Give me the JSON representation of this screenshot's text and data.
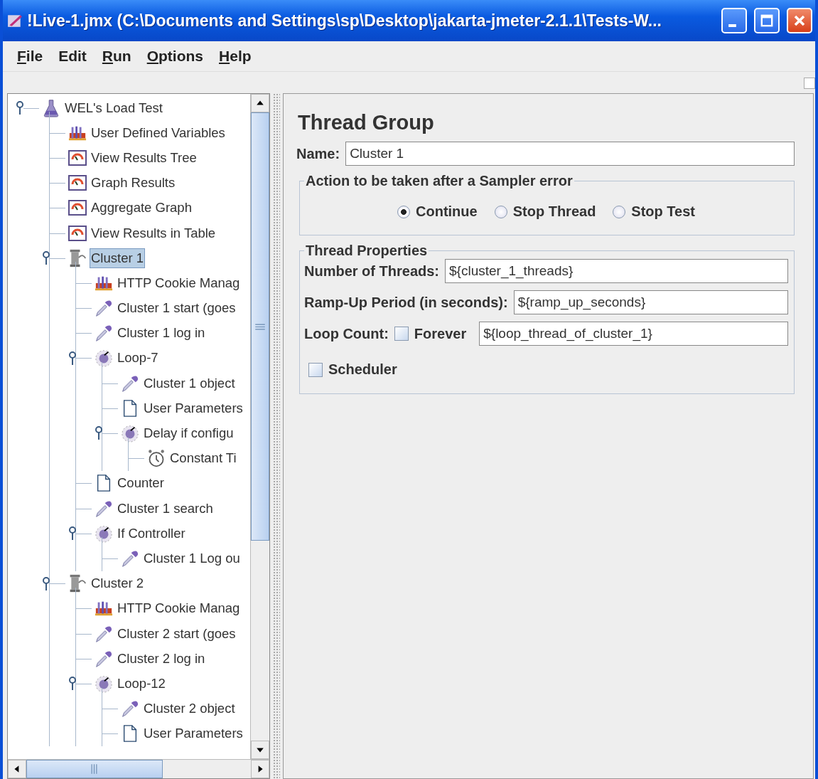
{
  "window": {
    "title": "!Live-1.jmx (C:\\Documents and Settings\\sp\\Desktop\\jakarta-jmeter-2.1.1\\Tests-W..."
  },
  "menu": [
    {
      "label": "File",
      "mnemonic": true
    },
    {
      "label": "Edit",
      "mnemonic": false
    },
    {
      "label": "Run",
      "mnemonic": true
    },
    {
      "label": "Options",
      "mnemonic": true
    },
    {
      "label": "Help",
      "mnemonic": true
    }
  ],
  "tree": [
    {
      "label": "WEL's Load Test",
      "kind": "plan",
      "expanded": true,
      "selected": false,
      "children": [
        {
          "label": "User Defined Variables",
          "kind": "config",
          "selected": false
        },
        {
          "label": "View Results Tree",
          "kind": "listener",
          "selected": false
        },
        {
          "label": "Graph Results",
          "kind": "listener",
          "selected": false
        },
        {
          "label": "Aggregate Graph",
          "kind": "listener",
          "selected": false
        },
        {
          "label": "View Results in Table",
          "kind": "listener",
          "selected": false
        },
        {
          "label": "Cluster 1",
          "kind": "thread",
          "expanded": true,
          "selected": true,
          "children": [
            {
              "label": "HTTP Cookie Manag",
              "kind": "config",
              "selected": false
            },
            {
              "label": "Cluster 1 start (goes",
              "kind": "sampler",
              "selected": false
            },
            {
              "label": "Cluster 1 log in",
              "kind": "sampler",
              "selected": false
            },
            {
              "label": "Loop-7",
              "kind": "controller",
              "expanded": true,
              "selected": false,
              "children": [
                {
                  "label": "Cluster 1 object",
                  "kind": "sampler",
                  "selected": false
                },
                {
                  "label": "User Parameters",
                  "kind": "page",
                  "selected": false
                },
                {
                  "label": "Delay if configu",
                  "kind": "controller",
                  "expanded": true,
                  "selected": false,
                  "children": [
                    {
                      "label": "Constant Ti",
                      "kind": "timer",
                      "selected": false
                    }
                  ]
                }
              ]
            },
            {
              "label": "Counter",
              "kind": "page",
              "selected": false
            },
            {
              "label": "Cluster 1 search",
              "kind": "sampler",
              "selected": false
            },
            {
              "label": "If Controller",
              "kind": "controller",
              "expanded": true,
              "selected": false,
              "children": [
                {
                  "label": "Cluster 1 Log ou",
                  "kind": "sampler",
                  "selected": false
                }
              ]
            }
          ]
        },
        {
          "label": "Cluster 2",
          "kind": "thread",
          "expanded": true,
          "selected": false,
          "children": [
            {
              "label": "HTTP Cookie Manag",
              "kind": "config",
              "selected": false
            },
            {
              "label": "Cluster 2 start (goes",
              "kind": "sampler",
              "selected": false
            },
            {
              "label": "Cluster 2 log in",
              "kind": "sampler",
              "selected": false
            },
            {
              "label": "Loop-12",
              "kind": "controller",
              "expanded": true,
              "selected": false,
              "children": [
                {
                  "label": "Cluster 2 object",
                  "kind": "sampler",
                  "selected": false
                },
                {
                  "label": "User Parameters",
                  "kind": "page",
                  "selected": false
                }
              ]
            }
          ]
        }
      ]
    }
  ],
  "panel": {
    "title": "Thread Group",
    "name_label": "Name:",
    "name_value": "Cluster 1",
    "error_group": {
      "title": "Action to be taken after a Sampler error",
      "options": [
        {
          "label": "Continue",
          "selected": true
        },
        {
          "label": "Stop Thread",
          "selected": false
        },
        {
          "label": "Stop Test",
          "selected": false
        }
      ]
    },
    "properties": {
      "title": "Thread Properties",
      "threads": {
        "label": "Number of Threads:",
        "value": "${cluster_1_threads}"
      },
      "ramp_up": {
        "label": "Ramp-Up Period (in seconds):",
        "value": "${ramp_up_seconds}"
      },
      "loop": {
        "label": "Loop Count:",
        "forever": {
          "label": "Forever",
          "checked": false
        },
        "value": "${loop_thread_of_cluster_1}"
      },
      "scheduler": {
        "label": "Scheduler",
        "checked": false
      }
    }
  }
}
